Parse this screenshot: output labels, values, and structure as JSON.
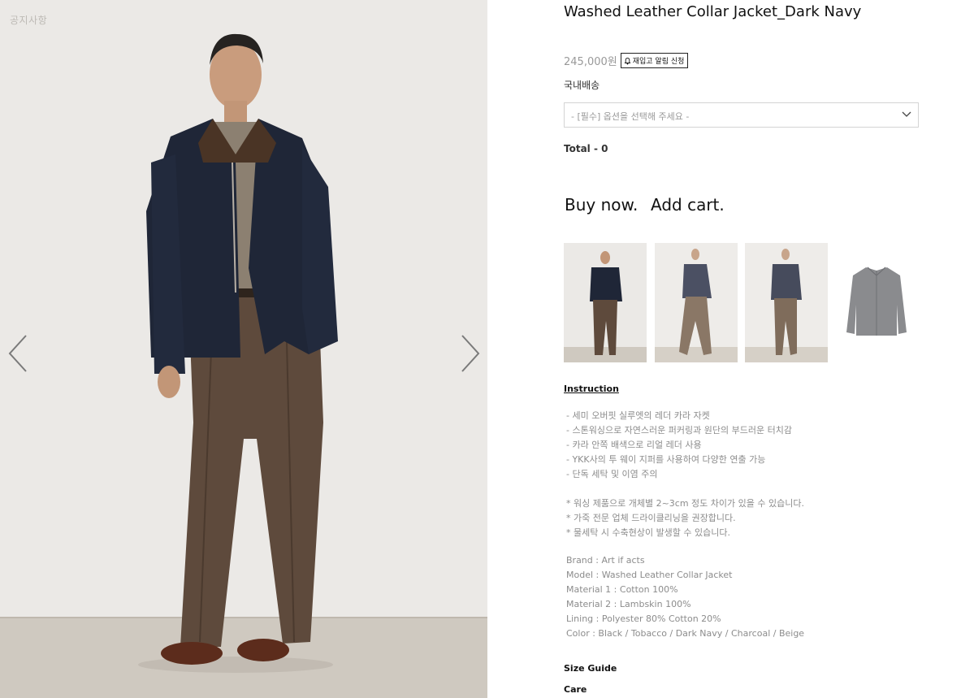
{
  "hero": {
    "notice": "공지사항",
    "prev_icon": "chevron-left-icon",
    "next_icon": "chevron-right-icon"
  },
  "product": {
    "title": "Washed Leather Collar Jacket_Dark Navy",
    "price": "245,000원",
    "restock_label": "재입고 알림 신청",
    "restock_icon": "bell-icon",
    "shipping": "국내배송",
    "option_placeholder": "- [필수] 옵션을 선택해 주세요 -",
    "total": "Total - 0",
    "buy_now": "Buy now.",
    "add_cart": "Add cart."
  },
  "thumbnails": [
    {
      "name": "front-view"
    },
    {
      "name": "side-view"
    },
    {
      "name": "three-quarter-view"
    },
    {
      "name": "jacket-flat"
    }
  ],
  "instruction": {
    "title": "Instruction",
    "features": [
      "- 세미 오버핏 실루엣의 레더 카라 자켓",
      "- 스톤워싱으로 자연스러운 퍼커링과 원단의 부드러운 터치감",
      "- 카라 안쪽 배색으로 리얼 레더 사용",
      "- YKK사의 투 웨이 지퍼를 사용하여 다양한 연출 가능",
      "- 단독 세탁 및 이염 주의"
    ],
    "notes": [
      "* 워싱 제품으로 개체별 2~3cm 정도 차이가 있을 수 있습니다.",
      "* 가죽 전문 업체 드라이클리닝을 권장합니다.",
      "* 물세탁 시 수축현상이 발생할 수 있습니다."
    ],
    "specs": [
      "Brand : Art if acts",
      "Model : Washed Leather Collar Jacket",
      "Material 1 : Cotton 100%",
      "Material 2 : Lambskin 100%",
      "Lining : Polyester 80% Cotton 20%",
      "Color : Black / Tobacco / Dark Navy / Charcoal / Beige"
    ]
  },
  "links": {
    "size_guide": "Size Guide",
    "care": "Care"
  },
  "colors": {
    "jacket": "#1f2637",
    "trousers": "#5e4a3c",
    "wall": "#e9e7e3",
    "floor": "#cfc9c0"
  }
}
